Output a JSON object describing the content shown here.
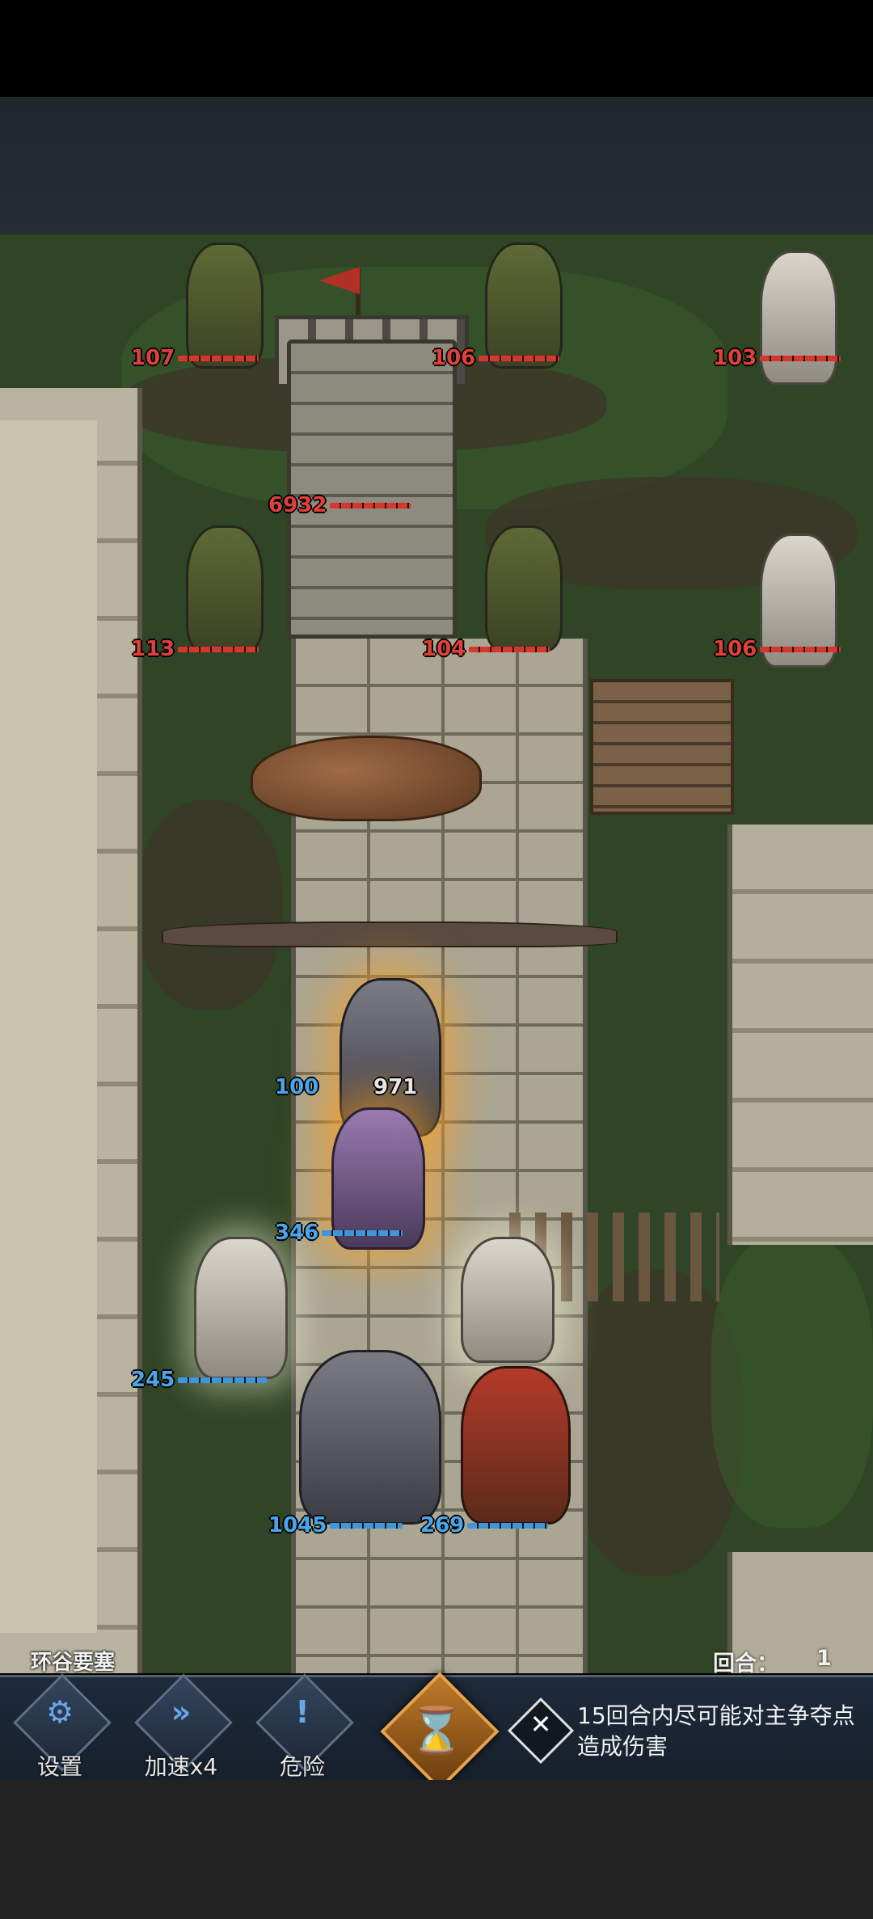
{
  "map": {
    "name": "环谷要塞"
  },
  "round": {
    "label": "回合：",
    "value": "1"
  },
  "objective": {
    "text": "15回合内尽可能对主争夺点造成伤害",
    "icon": "crossed-swords-icon"
  },
  "controls": [
    {
      "id": "settings",
      "label": "设置",
      "icon": "gear-icon",
      "glyph": "⚙"
    },
    {
      "id": "speed",
      "label": "加速x4",
      "icon": "fast-forward-icon",
      "glyph": "»"
    },
    {
      "id": "danger",
      "label": "危险",
      "icon": "exclamation-icon",
      "glyph": "!"
    }
  ],
  "end_turn": {
    "icon": "hourglass-icon",
    "glyph": "⌛"
  },
  "enemies": {
    "archer_top_left": "107",
    "archer_top_mid": "106",
    "priest_top_right": "103",
    "tower": "6932",
    "archer_mid_left": "113",
    "archer_mid_right": "104",
    "priest_mid_right": "106"
  },
  "allies": {
    "warrior": "100",
    "warrior_shield": "971",
    "mage": "346",
    "bard": "245",
    "knight": "1045",
    "rider": "269"
  },
  "colors": {
    "enemy_hp": "#e0403a",
    "ally_hp": "#4aa6ec",
    "accent": "#c07a2a"
  }
}
